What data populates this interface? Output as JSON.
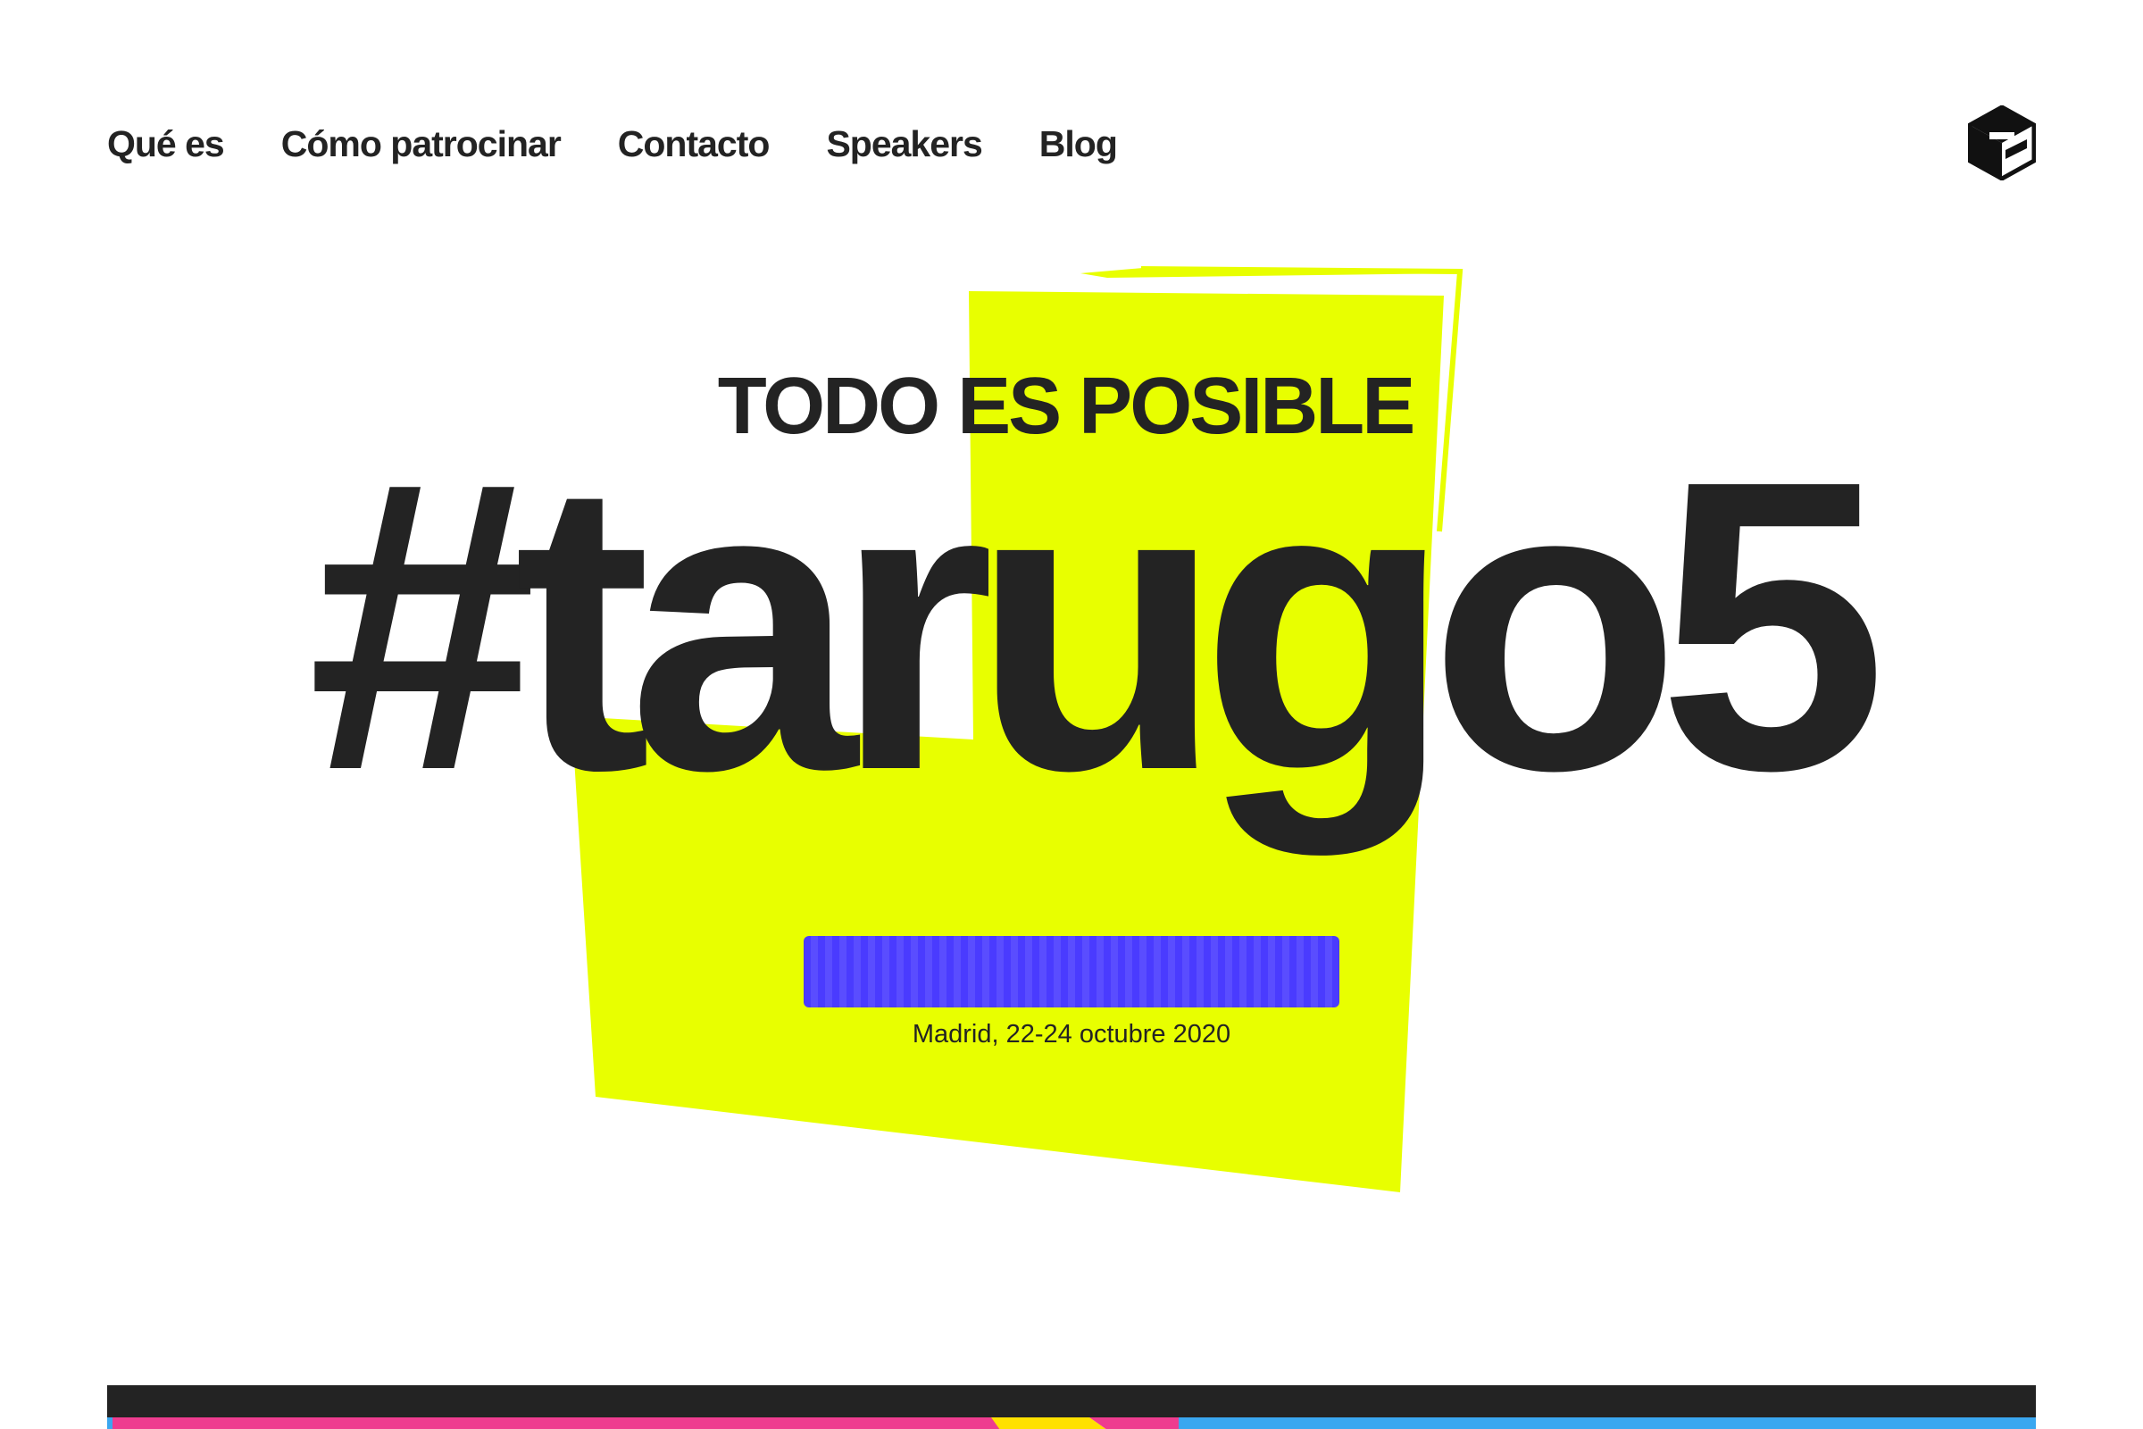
{
  "nav": {
    "items": [
      {
        "label": "Qué es"
      },
      {
        "label": "Cómo patrocinar"
      },
      {
        "label": "Contacto"
      },
      {
        "label": "Speakers"
      },
      {
        "label": "Blog"
      }
    ]
  },
  "hero": {
    "tagline": "TODO ES POSIBLE",
    "hashtag": "#tarugo5",
    "cta_label": "",
    "date": "Madrid, 22-24 octubre 2020"
  },
  "colors": {
    "accent_yellow": "#e8ff00",
    "cta_blue": "#4a3bff",
    "text_dark": "#232323",
    "band_pink": "#ee3c8f",
    "band_yellow": "#ffe100",
    "band_blue": "#3aa7f0"
  },
  "icons": {
    "logo": "cube-logo-icon"
  }
}
